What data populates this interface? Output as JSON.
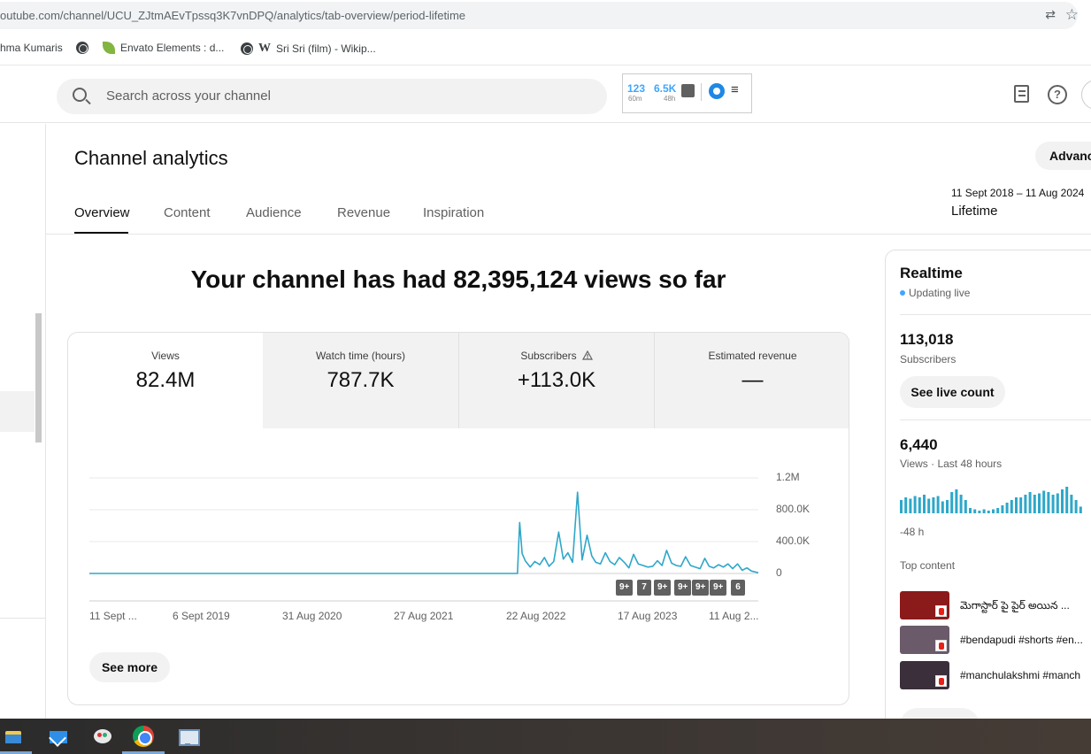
{
  "browser": {
    "url": "outube.com/channel/UCU_ZJtmAEvTpssq3K7vnDPQ/analytics/tab-overview/period-lifetime",
    "bookmarks": [
      {
        "label": "hma Kumaris"
      },
      {
        "label": "Envato Elements : d..."
      },
      {
        "label": "Sri Sri (film) - Wikip..."
      }
    ]
  },
  "header": {
    "search_placeholder": "Search across your channel",
    "extension": {
      "count_60m": "123",
      "count_48h": "6.5K",
      "sub_60m": "60m",
      "sub_48h": "48h"
    },
    "help_icon": "?"
  },
  "main": {
    "title": "Channel analytics",
    "advanced_button": "Advanc",
    "tabs": [
      {
        "label": "Overview",
        "active": true
      },
      {
        "label": "Content",
        "active": false
      },
      {
        "label": "Audience",
        "active": false
      },
      {
        "label": "Revenue",
        "active": false
      },
      {
        "label": "Inspiration",
        "active": false
      }
    ],
    "date_range": "11 Sept 2018 – 11 Aug 2024",
    "period_label": "Lifetime",
    "headline": "Your channel has had 82,395,124 views so far",
    "metrics": [
      {
        "label": "Views",
        "value": "82.4M",
        "selected": true
      },
      {
        "label": "Watch time (hours)",
        "value": "787.7K",
        "selected": false
      },
      {
        "label": "Subscribers",
        "value": "+113.0K",
        "selected": false,
        "warning": true
      },
      {
        "label": "Estimated revenue",
        "value": "—",
        "selected": false
      }
    ],
    "see_more": "See more"
  },
  "chart_data": {
    "type": "line",
    "title": "",
    "xlabel": "",
    "ylabel": "",
    "y_ticks": [
      "1.2M",
      "800.0K",
      "400.0K",
      "0"
    ],
    "ylim": [
      0,
      1200000
    ],
    "x_tick_labels": [
      "11 Sept ...",
      "6 Sept 2019",
      "31 Aug 2020",
      "27 Aug 2021",
      "22 Aug 2022",
      "17 Aug 2023",
      "11 Aug 2..."
    ],
    "x_range": [
      "2018-09-11",
      "2024-08-11"
    ],
    "grid": true,
    "series": [
      {
        "color": "#2ea7c9",
        "x": [
          "2018-09-11",
          "2022-06-10",
          "2022-06-25",
          "2022-07-02",
          "2022-07-10",
          "2022-07-20",
          "2022-08-05",
          "2022-08-20",
          "2022-09-05",
          "2022-09-20",
          "2022-10-05",
          "2022-10-20",
          "2022-11-05",
          "2022-11-20",
          "2022-12-05",
          "2022-12-20",
          "2023-01-05",
          "2023-01-20",
          "2023-02-05",
          "2023-02-20",
          "2023-03-05",
          "2023-03-20",
          "2023-04-05",
          "2023-04-20",
          "2023-05-05",
          "2023-05-20",
          "2023-06-05",
          "2023-06-20",
          "2023-07-05",
          "2023-07-20",
          "2023-08-05",
          "2023-08-20",
          "2023-09-05",
          "2023-09-20",
          "2023-10-05",
          "2023-10-20",
          "2023-11-05",
          "2023-11-20",
          "2023-12-05",
          "2023-12-20",
          "2024-01-05",
          "2024-01-20",
          "2024-02-05",
          "2024-02-20",
          "2024-03-05",
          "2024-03-20",
          "2024-04-05",
          "2024-04-20",
          "2024-05-05",
          "2024-05-20",
          "2024-06-05",
          "2024-06-20",
          "2024-07-05",
          "2024-07-20",
          "2024-08-11"
        ],
        "y": [
          0,
          0,
          0,
          640000,
          250000,
          160000,
          80000,
          150000,
          110000,
          200000,
          90000,
          150000,
          520000,
          180000,
          260000,
          140000,
          1020000,
          170000,
          480000,
          220000,
          140000,
          120000,
          260000,
          150000,
          110000,
          200000,
          140000,
          70000,
          240000,
          120000,
          100000,
          80000,
          90000,
          160000,
          100000,
          290000,
          130000,
          100000,
          90000,
          210000,
          100000,
          80000,
          60000,
          190000,
          90000,
          70000,
          110000,
          80000,
          120000,
          60000,
          120000,
          40000,
          70000,
          30000,
          10000
        ]
      }
    ],
    "notification_badges": [
      "9+",
      "7",
      "9+",
      "9+",
      "9+",
      "9+",
      "6"
    ]
  },
  "realtime": {
    "title": "Realtime",
    "live_label": "Updating live",
    "subscribers_value": "113,018",
    "subscribers_label": "Subscribers",
    "live_count_button": "See live count",
    "views_value": "6,440",
    "views_label": "Views · Last 48 hours",
    "bars": [
      10,
      12,
      11,
      13,
      12,
      14,
      11,
      12,
      13,
      9,
      10,
      16,
      18,
      14,
      10,
      4,
      3,
      2,
      3,
      2,
      3,
      4,
      6,
      8,
      10,
      12,
      12,
      14,
      16,
      14,
      15,
      17,
      16,
      14,
      15,
      18,
      20,
      14,
      10,
      5
    ],
    "axis_start": "-48 h",
    "top_content_label": "Top content",
    "top_content": [
      {
        "title": "మెగాస్టార్ పై పైర్ అయిన ...",
        "thumb_color": "#8b1a1a"
      },
      {
        "title": "#bendapudi #shorts #en...",
        "thumb_color": "#6a5a6a"
      },
      {
        "title": "#manchulakshmi #manch",
        "thumb_color": "#3a2f3a"
      }
    ]
  },
  "taskbar": {
    "icons": [
      "file-explorer-icon",
      "mail-icon",
      "paint-icon",
      "chrome-icon",
      "remote-desktop-icon"
    ]
  }
}
